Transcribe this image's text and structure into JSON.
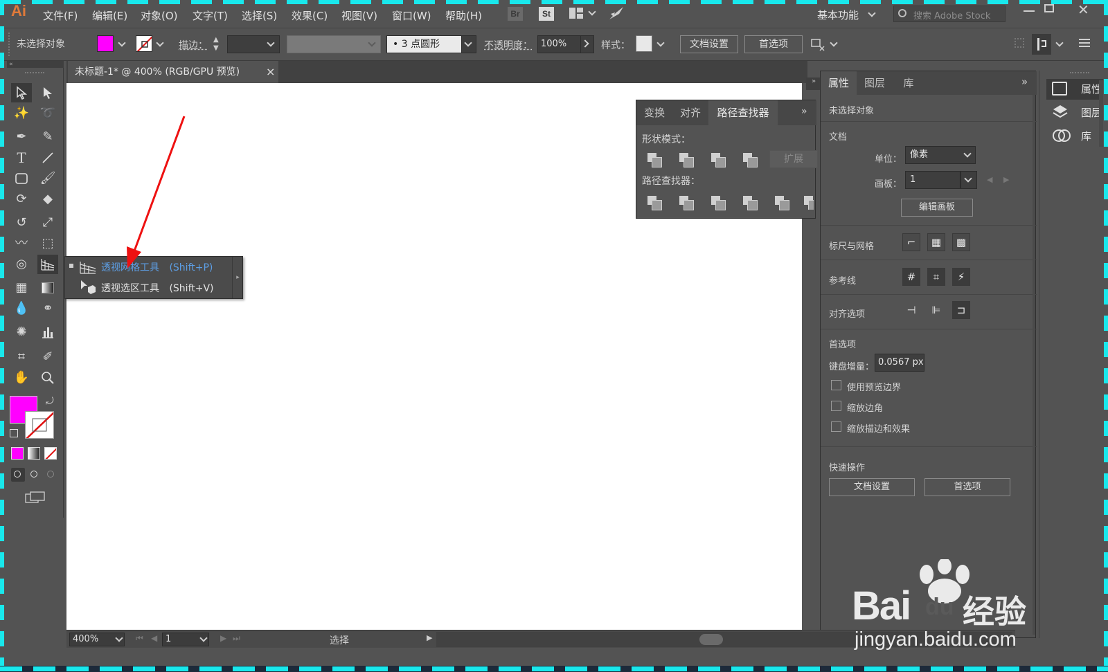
{
  "app": {
    "logo": "Ai"
  },
  "menu": {
    "items": [
      "文件(F)",
      "编辑(E)",
      "对象(O)",
      "文字(T)",
      "选择(S)",
      "效果(C)",
      "视图(V)",
      "窗口(W)",
      "帮助(H)"
    ],
    "bridge": "Br",
    "stock": "St",
    "workspace": "基本功能",
    "search_placeholder": "搜索 Adobe Stock"
  },
  "control": {
    "no_selection": "未选择对象",
    "stroke_label": "描边：",
    "brush_value": "• 3 点圆形",
    "opacity_label": "不透明度：",
    "opacity_value": "100%",
    "style_label": "样式：",
    "doc_setup": "文档设置",
    "preferences": "首选项",
    "fill_color": "#ff00ff"
  },
  "document": {
    "tab_title": "未标题-1* @ 400% (RGB/GPU 预览)",
    "close": "×"
  },
  "status": {
    "zoom": "400%",
    "artboard": "1",
    "tool": "选择"
  },
  "flyout": {
    "items": [
      {
        "label": "透视网格工具",
        "shortcut": "(Shift+P)"
      },
      {
        "label": "透视选区工具",
        "shortcut": "(Shift+V)"
      }
    ]
  },
  "pathfinder": {
    "tabs": [
      "变换",
      "对齐",
      "路径查找器"
    ],
    "shape_modes": "形状模式：",
    "expand": "扩展",
    "pathfinders": "路径查找器："
  },
  "properties": {
    "tabs": [
      "属性",
      "图层",
      "库"
    ],
    "no_selection": "未选择对象",
    "document": "文档",
    "units_label": "单位：",
    "units_value": "像素",
    "artboard_label": "画板：",
    "artboard_value": "1",
    "edit_artboards": "编辑画板",
    "rulers_grids": "标尺与网格",
    "guides": "参考线",
    "snap_options": "对齐选项",
    "preferences": "首选项",
    "keyboard_increment": "键盘增量：",
    "keyboard_value": "0.0567 px",
    "checkboxes": [
      "使用预览边界",
      "缩放边角",
      "缩放描边和效果"
    ],
    "quick_actions": "快速操作",
    "doc_setup": "文档设置",
    "prefs_button": "首选项"
  },
  "dock": {
    "items": [
      "属性",
      "图层",
      "库"
    ]
  },
  "watermark": {
    "brand": "Bai",
    "du": "du",
    "cn": "经验",
    "url": "jingyan.baidu.com"
  }
}
